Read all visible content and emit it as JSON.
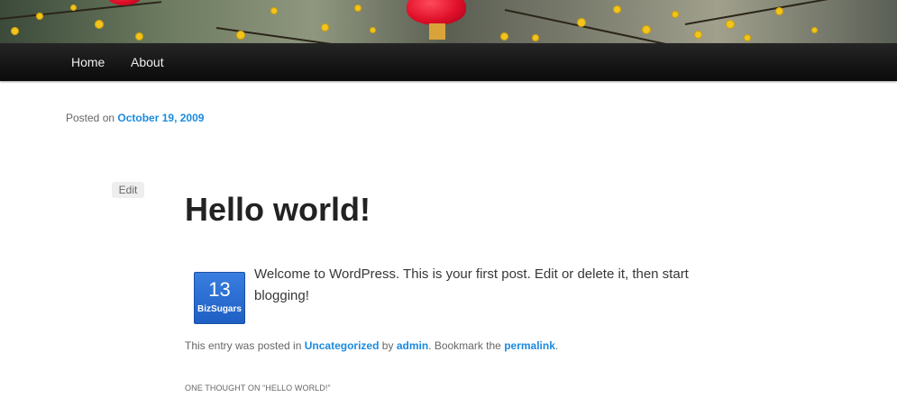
{
  "nav": {
    "items": [
      {
        "label": "Home"
      },
      {
        "label": "About"
      }
    ]
  },
  "post": {
    "posted_on_label": "Posted on",
    "date": "October 19, 2009",
    "edit_label": "Edit",
    "title": "Hello world!",
    "content": "Welcome to WordPress. This is your first post. Edit or delete it, then start blogging!",
    "meta": {
      "prefix": "This entry was posted in",
      "category": "Uncategorized",
      "by": "by",
      "author": "admin",
      "bookmark": ". Bookmark the",
      "permalink": "permalink",
      "suffix": "."
    }
  },
  "share_widget": {
    "count": "13",
    "label": "BizSugars"
  },
  "comments": {
    "title": "ONE THOUGHT ON “HELLO WORLD!”"
  },
  "colors": {
    "link": "#1b8be0",
    "nav_bg": "#111111",
    "widget": "#2a6fd6"
  },
  "icons": {
    "header": "branded-header-image"
  }
}
